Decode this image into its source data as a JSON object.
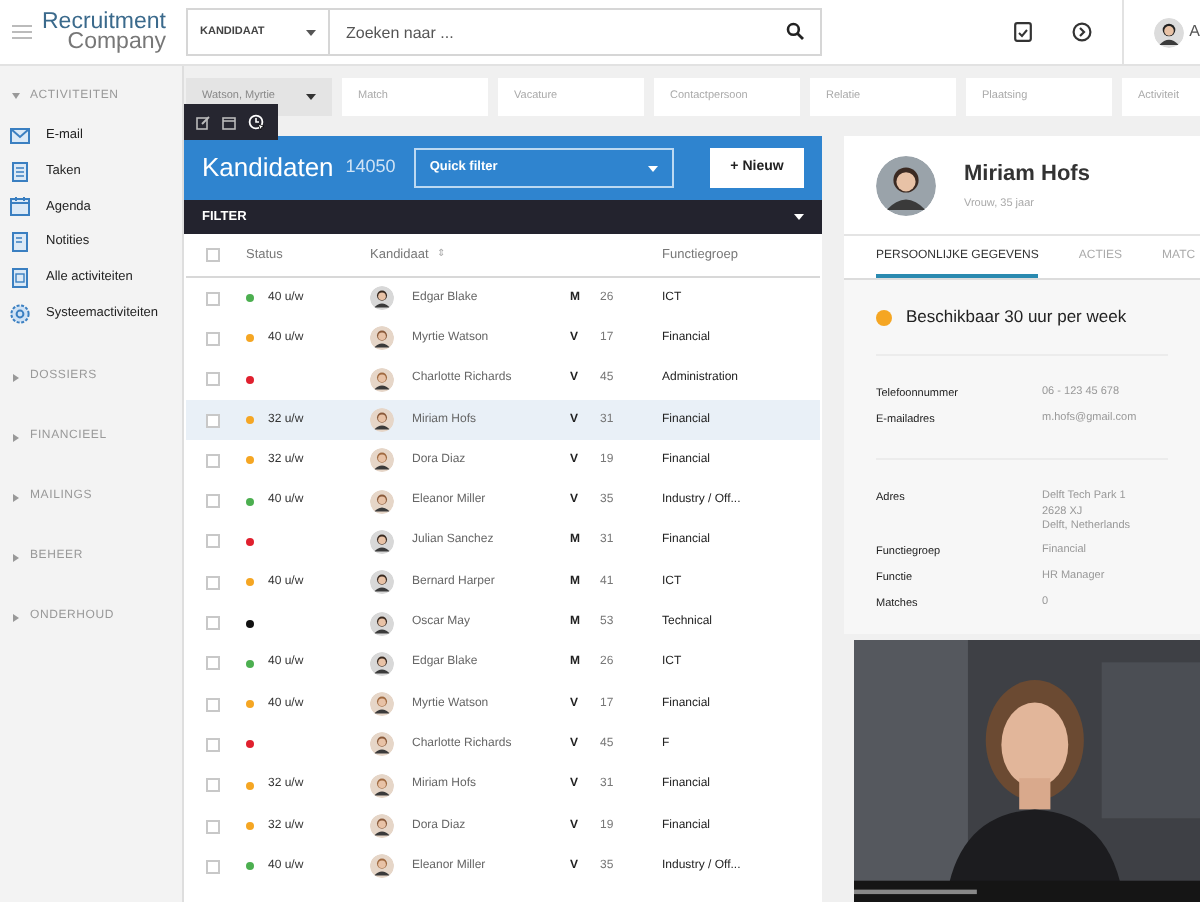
{
  "logo": {
    "line_1": "Recruitment",
    "line_2": "Company"
  },
  "search": {
    "scope": "KANDIDAAT",
    "placeholder": "Zoeken naar ..."
  },
  "user": {
    "initial": "A"
  },
  "record_tabs": [
    {
      "label": "Watson, Myrtie",
      "selected": true
    },
    {
      "label": "Match",
      "selected": false
    },
    {
      "label": "Vacature",
      "selected": false
    },
    {
      "label": "Contactpersoon",
      "selected": false
    },
    {
      "label": "Relatie",
      "selected": false
    },
    {
      "label": "Plaatsing",
      "selected": false
    },
    {
      "label": "Activiteit",
      "selected": false
    }
  ],
  "sidebar": [
    {
      "label": "ACTIVITEITEN",
      "expanded": true,
      "items": [
        {
          "label": "E-mail",
          "kind": "mail"
        },
        {
          "label": "Taken",
          "kind": "task"
        },
        {
          "label": "Agenda",
          "kind": "calendar"
        },
        {
          "label": "Notities",
          "kind": "note"
        },
        {
          "label": "Alle activiteiten",
          "kind": "list"
        },
        {
          "label": "Systeemactiviteiten",
          "kind": "gear"
        }
      ]
    },
    {
      "label": "DOSSIERS",
      "expanded": false
    },
    {
      "label": "FINANCIEEL",
      "expanded": false
    },
    {
      "label": "MAILINGS",
      "expanded": false
    },
    {
      "label": "BEHEER",
      "expanded": false
    },
    {
      "label": "ONDERHOUD",
      "expanded": false
    }
  ],
  "list": {
    "all_checked": false,
    "title": "Kandidaten",
    "count": "14050",
    "quick_filter": "Quick filter",
    "new_button": "+ Nieuw",
    "filter_label": "FILTER",
    "columns": {
      "status": "Status",
      "candidate": "Kandidaat",
      "sort_mark": "⇕",
      "group": "Functiegroep"
    },
    "rows": [
      {
        "checked": false,
        "selected": false,
        "color": "#4caf50",
        "hours": "40 u/w",
        "name": "Edgar Blake",
        "gender": "M",
        "age": "26",
        "group": "ICT"
      },
      {
        "checked": false,
        "selected": false,
        "color": "#f5a623",
        "hours": "40 u/w",
        "name": "Myrtie Watson",
        "gender": "V",
        "age": "17",
        "group": "Financial"
      },
      {
        "checked": false,
        "selected": false,
        "color": "#e0202e",
        "name": "Charlotte Richards",
        "gender": "V",
        "age": "45",
        "group": "Administration"
      },
      {
        "checked": false,
        "selected": true,
        "color": "#f5a623",
        "hours": "32 u/w",
        "name": "Miriam Hofs",
        "gender": "V",
        "age": "31",
        "group": "Financial"
      },
      {
        "checked": false,
        "selected": false,
        "color": "#f5a623",
        "hours": "32 u/w",
        "name": "Dora Diaz",
        "gender": "V",
        "age": "19",
        "group": "Financial"
      },
      {
        "checked": false,
        "selected": false,
        "color": "#4caf50",
        "hours": "40 u/w",
        "name": "Eleanor Miller",
        "gender": "V",
        "age": "35",
        "group": "Industry / Off..."
      },
      {
        "checked": false,
        "selected": false,
        "color": "#e0202e",
        "name": "Julian Sanchez",
        "gender": "M",
        "age": "31",
        "group": "Financial"
      },
      {
        "checked": false,
        "selected": false,
        "color": "#f5a623",
        "hours": "40 u/w",
        "name": "Bernard Harper",
        "gender": "M",
        "age": "41",
        "group": "ICT"
      },
      {
        "checked": false,
        "selected": false,
        "color": "#111111",
        "name": "Oscar May",
        "gender": "M",
        "age": "53",
        "group": "Technical"
      },
      {
        "checked": false,
        "selected": false,
        "color": "#4caf50",
        "hours": "40 u/w",
        "name": "Edgar Blake",
        "gender": "M",
        "age": "26",
        "group": "ICT"
      },
      {
        "checked": false,
        "selected": false,
        "color": "#f5a623",
        "hours": "40 u/w",
        "name": "Myrtie Watson",
        "gender": "V",
        "age": "17",
        "group": "Financial"
      },
      {
        "checked": false,
        "selected": false,
        "color": "#e0202e",
        "name": "Charlotte Richards",
        "gender": "V",
        "age": "45",
        "group": "F"
      },
      {
        "checked": false,
        "selected": false,
        "color": "#f5a623",
        "hours": "32 u/w",
        "name": "Miriam Hofs",
        "gender": "V",
        "age": "31",
        "group": "Financial"
      },
      {
        "checked": false,
        "selected": false,
        "color": "#f5a623",
        "hours": "32 u/w",
        "name": "Dora Diaz",
        "gender": "V",
        "age": "19",
        "group": "Financial"
      },
      {
        "checked": false,
        "selected": false,
        "color": "#4caf50",
        "hours": "40 u/w",
        "name": "Eleanor Miller",
        "gender": "V",
        "age": "35",
        "group": "Industry / Off..."
      }
    ]
  },
  "detail": {
    "name": "Miriam Hofs",
    "subtitle": "Vrouw, 35 jaar",
    "tabs": [
      {
        "label": "PERSOONLIJKE GEGEVENS",
        "selected": true
      },
      {
        "label": "ACTIES",
        "selected": false
      },
      {
        "label": "MATC",
        "selected": false
      }
    ],
    "availability": {
      "text": "Beschikbaar 30 uur per week",
      "color": "#f5a623"
    },
    "field_groups": [
      [
        {
          "label": "Telefoonnummer",
          "lines": [
            "06 - 123 45 678"
          ]
        },
        {
          "label": "E-mailadres",
          "lines": [
            "m.hofs@gmail.com"
          ]
        }
      ],
      [
        {
          "label": "Adres",
          "lines": [
            "Delft Tech Park 1",
            "2628 XJ",
            "Delft, Netherlands"
          ]
        },
        {
          "label": "Functiegroep",
          "lines": [
            "Financial"
          ]
        },
        {
          "label": "Functie",
          "lines": [
            "HR Manager"
          ]
        },
        {
          "label": "Matches",
          "lines": [
            "0"
          ]
        }
      ]
    ],
    "video": {
      "kind": "picture"
    }
  }
}
